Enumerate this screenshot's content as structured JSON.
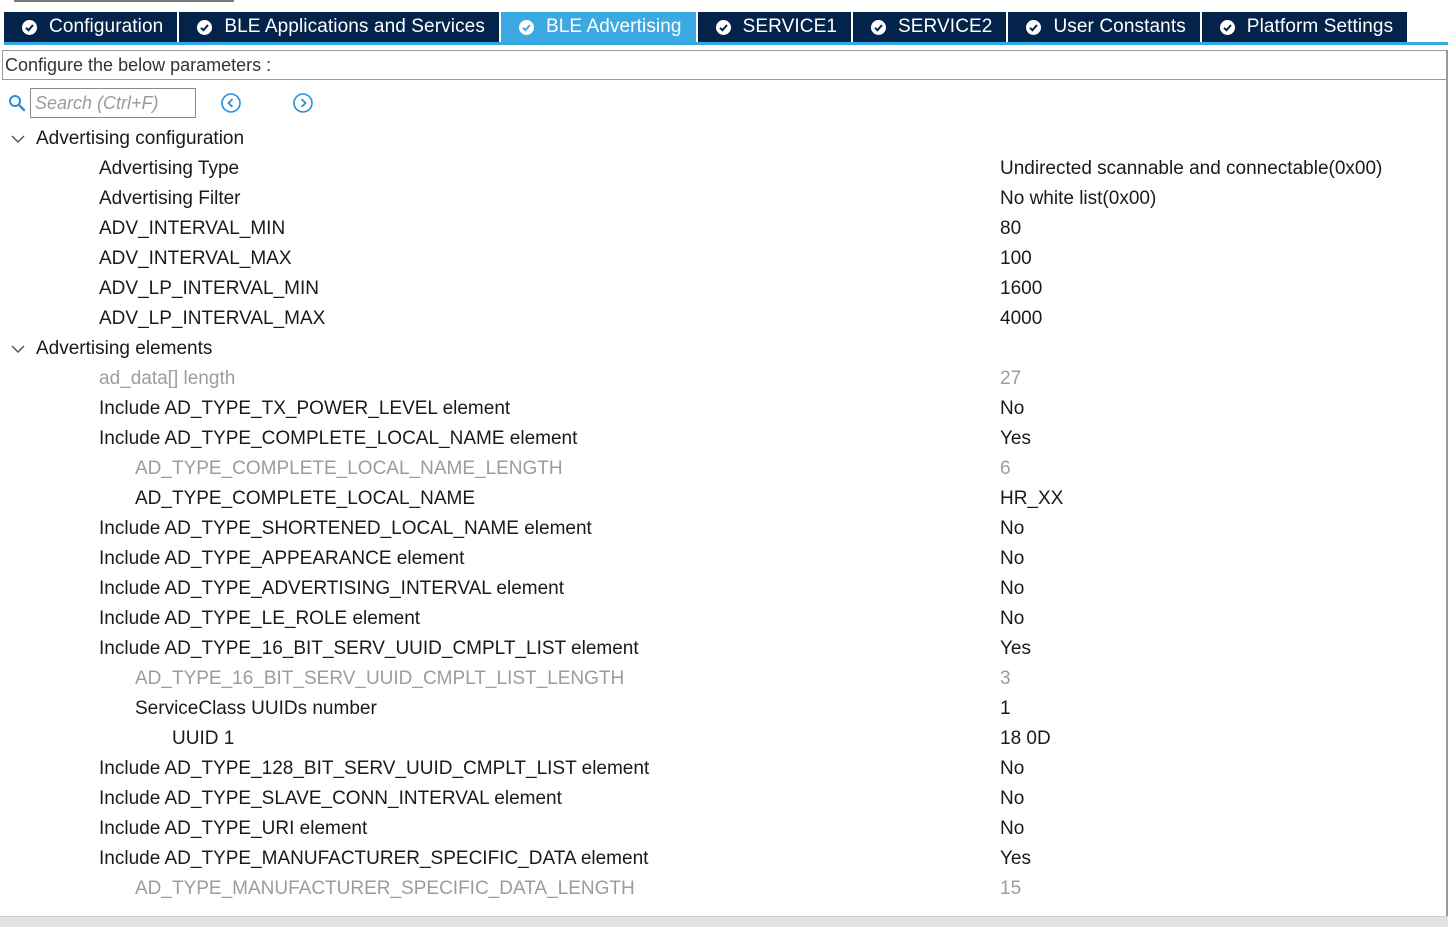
{
  "tabs": [
    {
      "label": "Configuration",
      "active": false
    },
    {
      "label": "BLE Applications and Services",
      "active": false
    },
    {
      "label": "BLE Advertising",
      "active": true
    },
    {
      "label": "SERVICE1",
      "active": false
    },
    {
      "label": "SERVICE2",
      "active": false
    },
    {
      "label": "User Constants",
      "active": false
    },
    {
      "label": "Platform Settings",
      "active": false
    }
  ],
  "configure_label": "Configure the below parameters :",
  "search": {
    "placeholder": "Search (Ctrl+F)",
    "value": ""
  },
  "colors": {
    "tab_bg": "#03234b",
    "tab_active_bg": "#3ca9e2",
    "disabled_text": "#9c9c9c"
  },
  "tree": {
    "groups": [
      {
        "label": "Advertising configuration",
        "items": [
          {
            "label": "Advertising Type",
            "value": "Undirected scannable and connectable(0x00)",
            "level": 1,
            "disabled": false
          },
          {
            "label": "Advertising Filter",
            "value": "No white list(0x00)",
            "level": 1,
            "disabled": false
          },
          {
            "label": "ADV_INTERVAL_MIN",
            "value": "80",
            "level": 1,
            "disabled": false
          },
          {
            "label": "ADV_INTERVAL_MAX",
            "value": "100",
            "level": 1,
            "disabled": false
          },
          {
            "label": "ADV_LP_INTERVAL_MIN",
            "value": "1600",
            "level": 1,
            "disabled": false
          },
          {
            "label": "ADV_LP_INTERVAL_MAX",
            "value": "4000",
            "level": 1,
            "disabled": false
          }
        ]
      },
      {
        "label": "Advertising elements",
        "items": [
          {
            "label": "ad_data[] length",
            "value": "27",
            "level": 1,
            "disabled": true
          },
          {
            "label": "Include AD_TYPE_TX_POWER_LEVEL element",
            "value": "No",
            "level": 1,
            "disabled": false
          },
          {
            "label": "Include AD_TYPE_COMPLETE_LOCAL_NAME element",
            "value": "Yes",
            "level": 1,
            "disabled": false
          },
          {
            "label": "AD_TYPE_COMPLETE_LOCAL_NAME_LENGTH",
            "value": "6",
            "level": 2,
            "disabled": true
          },
          {
            "label": "AD_TYPE_COMPLETE_LOCAL_NAME",
            "value": "HR_XX",
            "level": 2,
            "disabled": false
          },
          {
            "label": "Include AD_TYPE_SHORTENED_LOCAL_NAME  element",
            "value": "No",
            "level": 1,
            "disabled": false
          },
          {
            "label": "Include AD_TYPE_APPEARANCE element",
            "value": "No",
            "level": 1,
            "disabled": false
          },
          {
            "label": "Include AD_TYPE_ADVERTISING_INTERVAL element",
            "value": "No",
            "level": 1,
            "disabled": false
          },
          {
            "label": "Include AD_TYPE_LE_ROLE element",
            "value": "No",
            "level": 1,
            "disabled": false
          },
          {
            "label": "Include AD_TYPE_16_BIT_SERV_UUID_CMPLT_LIST element",
            "value": "Yes",
            "level": 1,
            "disabled": false
          },
          {
            "label": "AD_TYPE_16_BIT_SERV_UUID_CMPLT_LIST_LENGTH",
            "value": "3",
            "level": 2,
            "disabled": true
          },
          {
            "label": "ServiceClass UUIDs number",
            "value": "1",
            "level": 2,
            "disabled": false
          },
          {
            "label": "UUID 1",
            "value": "18 0D",
            "level": 3,
            "disabled": false
          },
          {
            "label": "Include AD_TYPE_128_BIT_SERV_UUID_CMPLT_LIST element",
            "value": "No",
            "level": 1,
            "disabled": false
          },
          {
            "label": "Include AD_TYPE_SLAVE_CONN_INTERVAL element",
            "value": "No",
            "level": 1,
            "disabled": false
          },
          {
            "label": "Include AD_TYPE_URI element",
            "value": "No",
            "level": 1,
            "disabled": false
          },
          {
            "label": "Include AD_TYPE_MANUFACTURER_SPECIFIC_DATA element",
            "value": "Yes",
            "level": 1,
            "disabled": false
          },
          {
            "label": "AD_TYPE_MANUFACTURER_SPECIFIC_DATA_LENGTH",
            "value": "15",
            "level": 2,
            "disabled": true
          }
        ]
      }
    ]
  }
}
